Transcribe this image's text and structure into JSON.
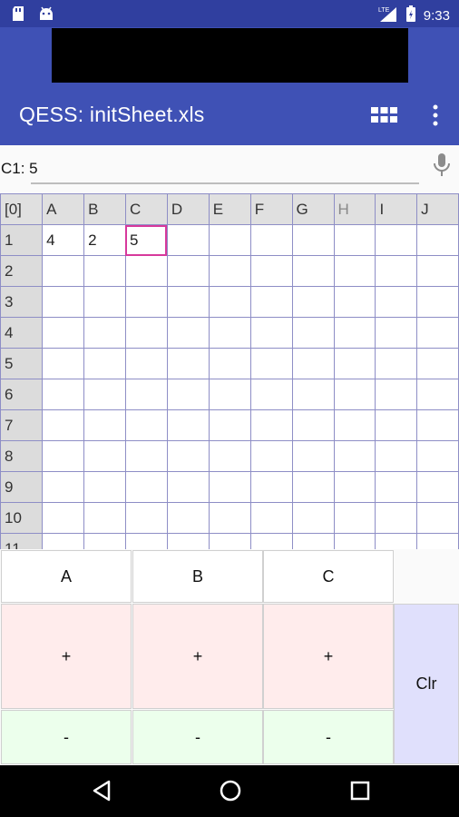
{
  "status_bar": {
    "time": "9:33",
    "network": "LTE",
    "left_icons": [
      "sd-card-icon",
      "android-icon"
    ],
    "right_icons": [
      "signal-icon",
      "battery-icon"
    ]
  },
  "app_bar": {
    "title": "QESS: initSheet.xls",
    "actions": [
      "grid-icon",
      "more-vert-icon"
    ]
  },
  "formula": {
    "value": "C1: 5"
  },
  "sheet": {
    "corner": "[0]",
    "columns": [
      "A",
      "B",
      "C",
      "D",
      "E",
      "F",
      "G",
      "H",
      "I",
      "J"
    ],
    "rows": [
      {
        "label": "1",
        "cells": [
          "4",
          "2",
          "5",
          "",
          "",
          "",
          "",
          "",
          "",
          ""
        ]
      },
      {
        "label": "2",
        "cells": [
          "",
          "",
          "",
          "",
          "",
          "",
          "",
          "",
          "",
          ""
        ]
      },
      {
        "label": "3",
        "cells": [
          "",
          "",
          "",
          "",
          "",
          "",
          "",
          "",
          "",
          ""
        ]
      },
      {
        "label": "4",
        "cells": [
          "",
          "",
          "",
          "",
          "",
          "",
          "",
          "",
          "",
          ""
        ]
      },
      {
        "label": "5",
        "cells": [
          "",
          "",
          "",
          "",
          "",
          "",
          "",
          "",
          "",
          ""
        ]
      },
      {
        "label": "6",
        "cells": [
          "",
          "",
          "",
          "",
          "",
          "",
          "",
          "",
          "",
          ""
        ]
      },
      {
        "label": "7",
        "cells": [
          "",
          "",
          "",
          "",
          "",
          "",
          "",
          "",
          "",
          ""
        ]
      },
      {
        "label": "8",
        "cells": [
          "",
          "",
          "",
          "",
          "",
          "",
          "",
          "",
          "",
          ""
        ]
      },
      {
        "label": "9",
        "cells": [
          "",
          "",
          "",
          "",
          "",
          "",
          "",
          "",
          "",
          ""
        ]
      },
      {
        "label": "10",
        "cells": [
          "",
          "",
          "",
          "",
          "",
          "",
          "",
          "",
          "",
          ""
        ]
      },
      {
        "label": "11",
        "cells": [
          "",
          "",
          "",
          "",
          "",
          "",
          "",
          "",
          "",
          ""
        ]
      }
    ],
    "selected_cell": "C1"
  },
  "keypad": {
    "labels": [
      "A",
      "B",
      "C"
    ],
    "plus": [
      "+",
      "+",
      "+"
    ],
    "minus": [
      "-",
      "-",
      "-"
    ],
    "clear": "Clr"
  },
  "colors": {
    "primary": "#3f51b5",
    "primary_dark": "#303f9f",
    "grid_line": "#8e8ec6",
    "selection": "#d7399c",
    "plus_key": "#ffecec",
    "minus_key": "#ecffec",
    "clear_key": "#e0e0fc"
  },
  "nav_bar": {
    "buttons": [
      "back-icon",
      "home-icon",
      "recents-icon"
    ]
  }
}
